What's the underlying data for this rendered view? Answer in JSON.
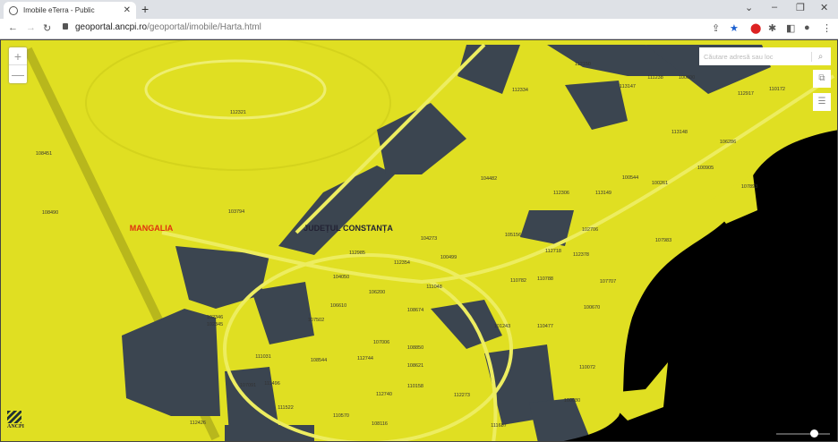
{
  "browser": {
    "tab_title": "Imobile eTerra - Public",
    "url_host": "geoportal.ancpi.ro",
    "url_path": "/geoportal/imobile/Harta.html"
  },
  "map": {
    "search_placeholder": "Căutare adresă sau loc",
    "zoom_in": "+",
    "zoom_out": "—",
    "zoom_level_fraction": 0.65,
    "colors": {
      "parcel": "#e0df22",
      "built": "#3b4550",
      "sea": "#000000",
      "place_label": "#e03010"
    },
    "places": {
      "mangalia": "MANGALIA",
      "county": "JUDEȚUL CONSTANȚA"
    },
    "logo_text": "ANCPI",
    "parcels": [
      "112321",
      "108451",
      "108490",
      "103794",
      "112150",
      "113147",
      "111238",
      "100600",
      "112334",
      "112917",
      "110172",
      "104482",
      "113148",
      "106286",
      "100905",
      "112306",
      "113149",
      "100544",
      "100261",
      "107893",
      "104273",
      "100499",
      "105156",
      "102706",
      "107983",
      "112718",
      "112378",
      "112985",
      "112354",
      "111048",
      "104050",
      "106200",
      "110782",
      "110788",
      "107707",
      "108674",
      "106610",
      "102346",
      "102345",
      "101243",
      "110477",
      "100670",
      "107502",
      "107006",
      "108850",
      "111031",
      "108544",
      "112744",
      "108621",
      "110072",
      "107091",
      "111496",
      "110158",
      "112740",
      "112273",
      "100080",
      "111522",
      "110570",
      "108116",
      "112426",
      "111687"
    ]
  }
}
